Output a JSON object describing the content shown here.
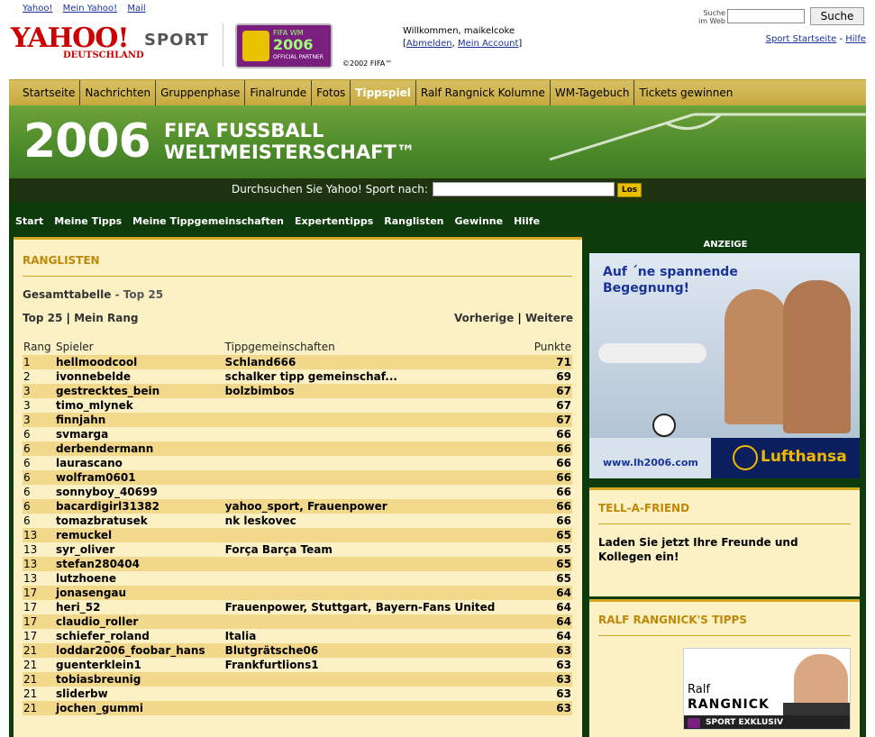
{
  "toplinks": [
    "Yahoo!",
    "Mein Yahoo!",
    "Mail"
  ],
  "logo": {
    "brand": "YAHOO!",
    "country": "DEUTSCHLAND",
    "section": "SPORT"
  },
  "fifa_badge": {
    "line1": "FIFA WM",
    "line2": "2006",
    "line3": "OFFICIAL PARTNER"
  },
  "copyright": "©2002 FIFA™",
  "welcome": {
    "text": "Willkommen, maikelcoke",
    "logout": "Abmelden",
    "account": "Mein Account"
  },
  "search_web": {
    "label_line1": "Suche",
    "label_line2": "im Web",
    "button": "Suche"
  },
  "right_links": {
    "start": "Sport Startseite",
    "help": "Hilfe"
  },
  "nav": [
    "Startseite",
    "Nachrichten",
    "Gruppenphase",
    "Finalrunde",
    "Fotos",
    "Tippspiel",
    "Ralf Rangnick Kolumne",
    "WM-Tagebuch",
    "Tickets gewinnen"
  ],
  "nav_active": "Tippspiel",
  "banner": {
    "year": "2006",
    "line1": "FIFA FUSSBALL",
    "line2": "WELTMEISTERSCHAFT™"
  },
  "sport_search": {
    "label": "Durchsuchen Sie Yahoo! Sport nach:",
    "button": "Los"
  },
  "game_nav": [
    "Start",
    "Meine Tipps",
    "Meine Tippgemeinschaften",
    "Expertentipps",
    "Ranglisten",
    "Gewinne",
    "Hilfe"
  ],
  "ranking": {
    "header": "RANGLISTEN",
    "subtitle": "Gesamttabelle",
    "subtitle_suffix": " - Top 25",
    "tab_top25": "Top 25",
    "tab_myrank": "Mein Rang",
    "prev": "Vorherige",
    "next": "Weitere",
    "columns": {
      "rank": "Rang",
      "player": "Spieler",
      "groups": "Tippgemeinschaften",
      "points": "Punkte"
    },
    "rows": [
      {
        "rank": "1",
        "player": "hellmoodcool",
        "groups": "Schland666",
        "points": "71"
      },
      {
        "rank": "2",
        "player": "ivonnebelde",
        "groups": "schalker tipp gemeinschaf...",
        "points": "69"
      },
      {
        "rank": "3",
        "player": "gestrecktes_bein",
        "groups": "bolzbimbos",
        "points": "67"
      },
      {
        "rank": "3",
        "player": "timo_mlynek",
        "groups": "",
        "points": "67"
      },
      {
        "rank": "3",
        "player": "finnjahn",
        "groups": "",
        "points": "67"
      },
      {
        "rank": "6",
        "player": "svmarga",
        "groups": "",
        "points": "66"
      },
      {
        "rank": "6",
        "player": "derbendermann",
        "groups": "",
        "points": "66"
      },
      {
        "rank": "6",
        "player": "laurascano",
        "groups": "",
        "points": "66"
      },
      {
        "rank": "6",
        "player": "wolfram0601",
        "groups": "",
        "points": "66"
      },
      {
        "rank": "6",
        "player": "sonnyboy_40699",
        "groups": "",
        "points": "66"
      },
      {
        "rank": "6",
        "player": "bacardigirl31382",
        "groups": "yahoo_sport, Frauenpower",
        "points": "66"
      },
      {
        "rank": "6",
        "player": "tomazbratusek",
        "groups": "nk leskovec",
        "points": "66"
      },
      {
        "rank": "13",
        "player": "remuckel",
        "groups": "",
        "points": "65"
      },
      {
        "rank": "13",
        "player": "syr_oliver",
        "groups": "Força Barça Team",
        "points": "65"
      },
      {
        "rank": "13",
        "player": "stefan280404",
        "groups": "",
        "points": "65"
      },
      {
        "rank": "13",
        "player": "lutzhoene",
        "groups": "",
        "points": "65"
      },
      {
        "rank": "17",
        "player": "jonasengau",
        "groups": "",
        "points": "64"
      },
      {
        "rank": "17",
        "player": "heri_52",
        "groups": "Frauenpower, Stuttgart, Bayern-Fans United",
        "points": "64"
      },
      {
        "rank": "17",
        "player": "claudio_roller",
        "groups": "",
        "points": "64"
      },
      {
        "rank": "17",
        "player": "schiefer_roland",
        "groups": "Italia",
        "points": "64"
      },
      {
        "rank": "21",
        "player": "loddar2006_foobar_hans",
        "groups": "Blutgrätsche06",
        "points": "63"
      },
      {
        "rank": "21",
        "player": "guenterklein1",
        "groups": "Frankfurtlions1",
        "points": "63"
      },
      {
        "rank": "21",
        "player": "tobiasbreunig",
        "groups": "",
        "points": "63"
      },
      {
        "rank": "21",
        "player": "sliderbw",
        "groups": "",
        "points": "63"
      },
      {
        "rank": "21",
        "player": "jochen_gummi",
        "groups": "",
        "points": "63"
      }
    ]
  },
  "ad": {
    "label": "ANZEIGE",
    "headline": "Auf ´ne spannende Begegnung!",
    "url": "www.lh2006.com",
    "brand": "Lufthansa"
  },
  "tell_friend": {
    "header": "TELL-A-FRIEND",
    "text": "Laden Sie jetzt Ihre Freunde und Kollegen ein!"
  },
  "rangnick": {
    "header": "RALF RANGNICK'S TIPPS",
    "first": "Ralf",
    "last": "RANGNICK",
    "tag": "SPORT EXKLUSIV"
  }
}
